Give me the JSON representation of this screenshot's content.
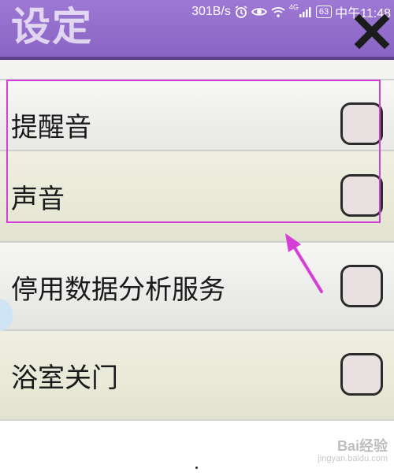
{
  "status_bar": {
    "net_speed": "301B/s",
    "network_type": "4G",
    "battery": "63",
    "time": "中午11:48",
    "icons": [
      "alarm-icon",
      "eye-icon",
      "wifi-icon",
      "signal-icon",
      "battery-icon"
    ]
  },
  "header": {
    "title": "设定",
    "close_icon": "close-icon",
    "color": "#8a64c4"
  },
  "settings": {
    "items": [
      {
        "label": "提醒音",
        "checked": false
      },
      {
        "label": "声音",
        "checked": false
      },
      {
        "label": "停用数据分析服务",
        "checked": false
      },
      {
        "label": "浴室关门",
        "checked": false
      }
    ]
  },
  "annotation": {
    "highlight_color": "#d63fd6"
  },
  "watermark": {
    "main": "Bai经验",
    "sub": "jingyan.baidu.com"
  }
}
